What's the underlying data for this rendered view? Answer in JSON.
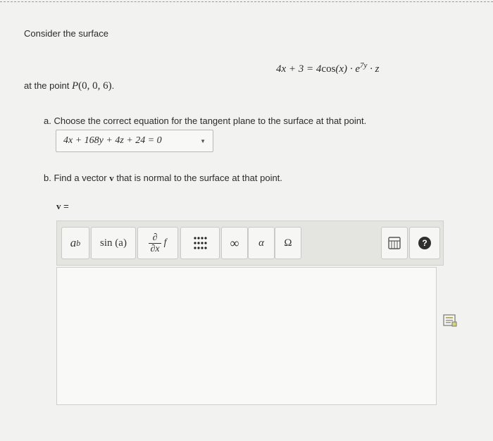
{
  "question": {
    "intro": "Consider the surface",
    "equation": {
      "lhs": "4x + 3 = 4",
      "cos": "cos",
      "arg": "(x)",
      "dot1": " · e",
      "exp": "7y",
      "tail": " · z"
    },
    "point_prefix": "at the point ",
    "point_label": "P",
    "point_coords": "(0, 0, 6)",
    "point_suffix": ".",
    "part_a": "a. Choose the correct equation for the tangent plane to the surface at that point.",
    "part_a_selected": "4x + 168y + 4z + 24 = 0",
    "part_b_prefix": "b. Find a vector ",
    "part_b_var": "v",
    "part_b_suffix": " that is normal to the surface at that point.",
    "answer_var": "v",
    "answer_eq": " ="
  },
  "toolbar": {
    "power_base": "a",
    "power_exp": "b",
    "sin": "sin (a)",
    "partial_num": "∂",
    "partial_den": "∂x",
    "partial_f": "f",
    "matrix": "⠿",
    "infinity": "∞",
    "alpha": "α",
    "omega": "Ω",
    "help": "?"
  },
  "colors": {
    "help_bg": "#2f2f2f",
    "background": "#f2f2f0"
  }
}
